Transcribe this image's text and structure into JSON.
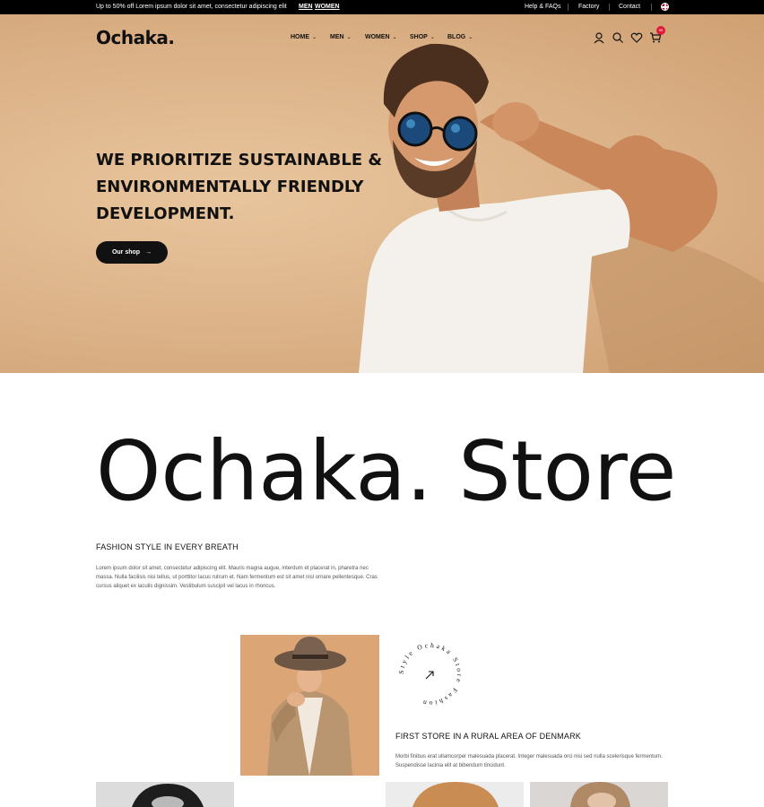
{
  "topbar": {
    "promo": "Up to 50% off Lorem ipsum dolor sit amet, consectetur adipiscing elit",
    "men": "MEN",
    "women": "WOMEN",
    "help": "Help & FAQs",
    "factory": "Factory",
    "contact": "Contact"
  },
  "header": {
    "logo": "Ochaka.",
    "nav": [
      "HOME",
      "MEN",
      "WOMEN",
      "SHOP",
      "BLOG"
    ],
    "cart_count": "99"
  },
  "hero": {
    "headline": [
      "WE PRIORITIZE SUSTAINABLE &",
      "ENVIRONMENTALLY FRIENDLY",
      "DEVELOPMENT."
    ],
    "cta": "Our shop"
  },
  "store": {
    "title": "Ochaka. Store",
    "subtitle": "FASHION STYLE IN EVERY BREATH",
    "description": "Lorem ipsum dolor sit amet, consectetur adipiscing elit. Mauris magna augue, interdum et placerat in, pharetra nec massa. Nulla facilisis nisi tellus, ut porttitor lacus rutrum et. Nam fermentum est sit amet nisl ornare pellentesque. Cras cursus aliquet ex iaculis dignissim. Vestibulum suscipit vel lacus in rhoncus.",
    "badge_text": "Style Ochaka Store Fashion",
    "first_store_title": "FIRST STORE IN A RURAL AREA OF DENMARK",
    "first_store_desc": "Morbi finibus erat ullamcorper malesuada placerat. Integer malesuada orci nisi sed nulla scelerisque fermentum. Suspendisse lacinia elit at bibendum tincidunt."
  },
  "colors": {
    "hero_bg": "#dcb288",
    "accent": "#111111",
    "badge": "#e31b3b"
  }
}
